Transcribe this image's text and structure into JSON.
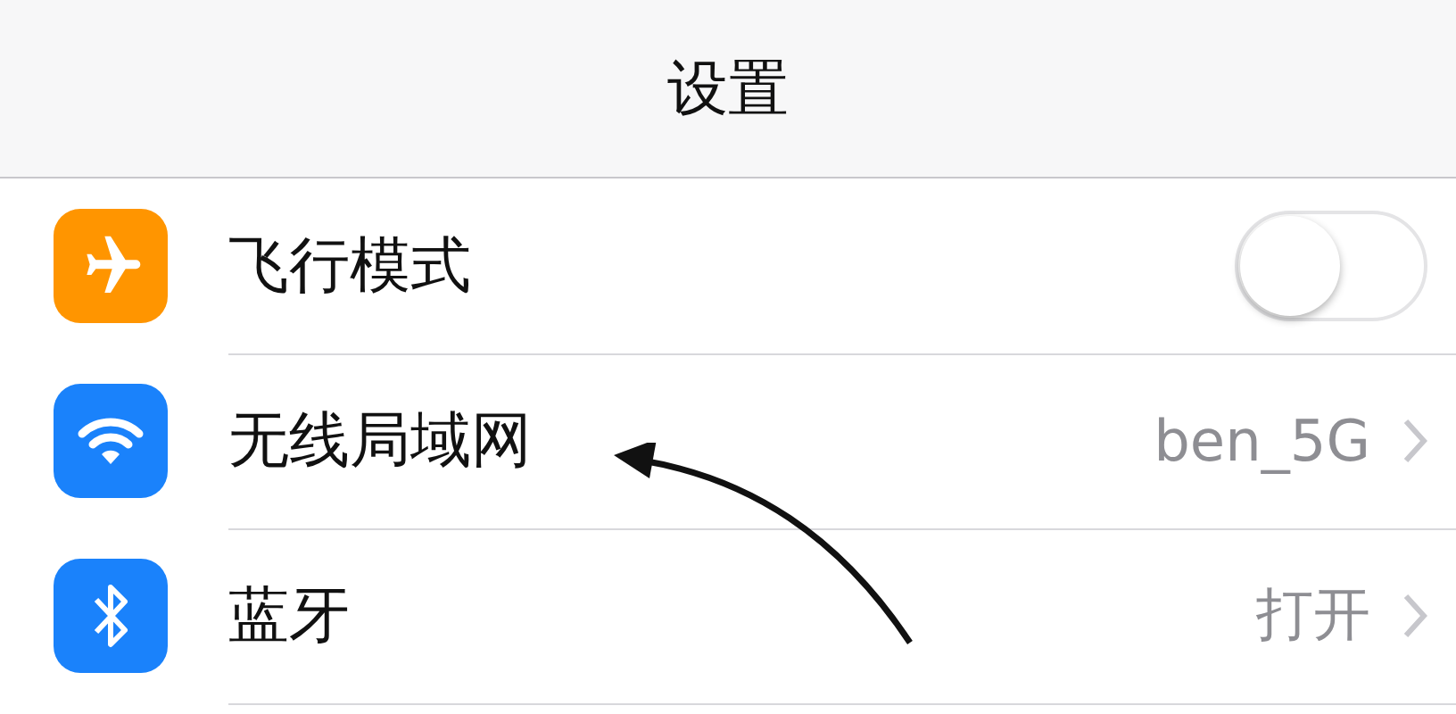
{
  "header": {
    "title": "设置"
  },
  "rows": [
    {
      "kind": "toggle",
      "color": "#ff9500",
      "label": "飞行模式",
      "on": false
    },
    {
      "kind": "link",
      "color": "#1a82fb",
      "label": "无线局域网",
      "value": "ben_5G"
    },
    {
      "kind": "link",
      "color": "#1a82fb",
      "label": "蓝牙",
      "value": "打开"
    }
  ]
}
